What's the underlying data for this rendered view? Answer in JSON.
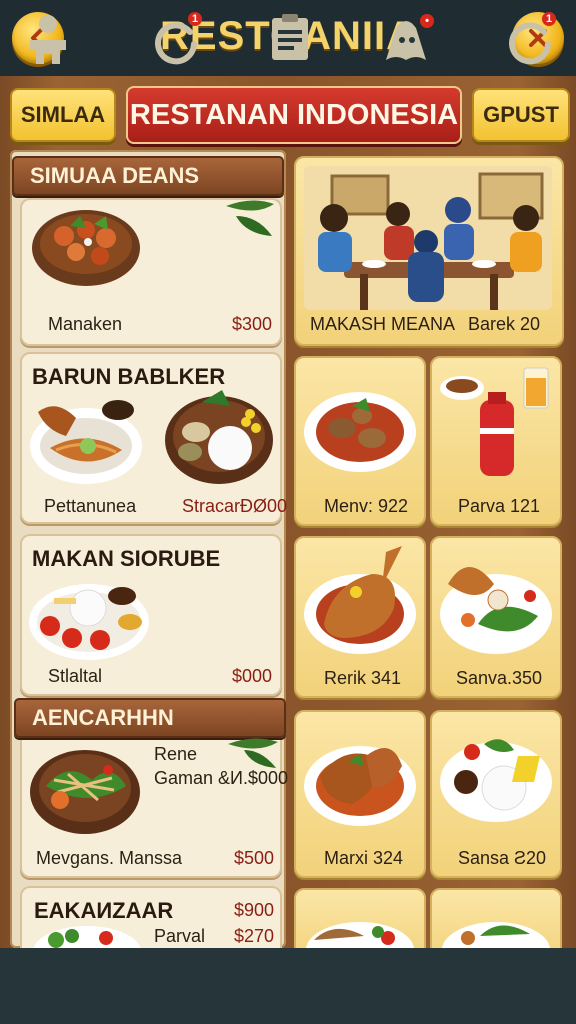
{
  "header": {
    "title": "RESTOANIIA",
    "back_icon": "chevron-left-icon",
    "close_icon": "close-icon"
  },
  "toolbar": {
    "left_button": "SIMLAA",
    "banner": "RESTANAN INDONESIA",
    "right_button": "GPUST"
  },
  "left_panel": {
    "section1": {
      "heading": "SIMUAA DEANS",
      "item": {
        "name": "Manaken",
        "price": "$300"
      }
    },
    "section2": {
      "heading": "BARUN BABLKER",
      "item_a": "Pettanunea",
      "item_b": "StracarĐØ00"
    },
    "section3": {
      "heading": "MAKAN SIORUBE",
      "item": {
        "name": "Stlaltal",
        "price": "$000"
      }
    },
    "section4": {
      "heading": "AENCARHHN",
      "line1": "Rene",
      "line2": "Gaman &И.$000",
      "item": {
        "name": "Mevgans. Manssa",
        "price": "$500"
      }
    },
    "section5": {
      "heading": "EAKAИZAAR",
      "price1": "$900",
      "name2": "Parval",
      "price2": "$270"
    }
  },
  "right_grid": {
    "featured": {
      "name": "MAKASH MEANA",
      "price": "Barek 20"
    },
    "cards": [
      {
        "label": "Menv: 922"
      },
      {
        "label": "Parva 121"
      },
      {
        "label": "Rerik 341"
      },
      {
        "label": "Sanva.350"
      },
      {
        "label": "Marxi 324"
      },
      {
        "label": "Sansa Ƨ20"
      }
    ]
  },
  "bottom_nav": [
    {
      "icon": "character-icon",
      "badge": ""
    },
    {
      "icon": "refresh-icon",
      "badge": "1"
    },
    {
      "icon": "clipboard-icon",
      "badge": ""
    },
    {
      "icon": "ghost-icon",
      "badge": "•"
    },
    {
      "icon": "refresh-icon",
      "badge": "1"
    }
  ],
  "colors": {
    "accent": "#f2c230",
    "banner": "#c02a20",
    "wood": "#8a552b",
    "panel": "#e9dcc0",
    "topbar": "#1f2d33"
  }
}
